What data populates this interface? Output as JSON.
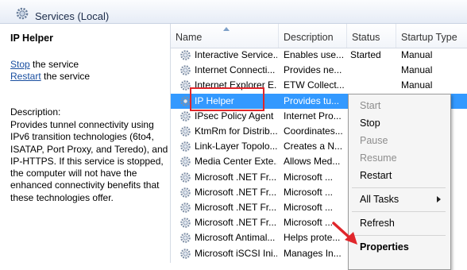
{
  "window": {
    "title": "Services (Local)",
    "icon": "gear-icon"
  },
  "left_pane": {
    "service_name": "IP Helper",
    "actions": [
      {
        "link": "Stop",
        "rest": " the service"
      },
      {
        "link": "Restart",
        "rest": " the service"
      }
    ],
    "description_label": "Description:",
    "description": "Provides tunnel connectivity using IPv6 transition technologies (6to4, ISATAP, Port Proxy, and Teredo), and IP-HTTPS. If this service is stopped, the computer will not have the enhanced connectivity benefits that these technologies offer."
  },
  "columns": {
    "name": "Name",
    "description": "Description",
    "status": "Status",
    "startup_type": "Startup Type"
  },
  "rows": [
    {
      "name": "Interactive Service...",
      "description": "Enables use...",
      "status": "Started",
      "startup": "Manual"
    },
    {
      "name": "Internet Connecti...",
      "description": "Provides ne...",
      "status": "",
      "startup": "Manual"
    },
    {
      "name": "Internet Explorer E...",
      "description": "ETW Collect...",
      "status": "",
      "startup": "Manual"
    },
    {
      "name": "IP Helper",
      "description": "Provides tu...",
      "status": "",
      "startup": "",
      "selected": true
    },
    {
      "name": "IPsec Policy Agent",
      "description": "Internet Pro...",
      "status": "",
      "startup": ""
    },
    {
      "name": "KtmRm for Distrib...",
      "description": "Coordinates...",
      "status": "",
      "startup": ""
    },
    {
      "name": "Link-Layer Topolo...",
      "description": "Creates a N...",
      "status": "",
      "startup": ""
    },
    {
      "name": "Media Center Exte...",
      "description": "Allows Med...",
      "status": "",
      "startup": ""
    },
    {
      "name": "Microsoft .NET Fr...",
      "description": "Microsoft ...",
      "status": "",
      "startup": ""
    },
    {
      "name": "Microsoft .NET Fr...",
      "description": "Microsoft ...",
      "status": "",
      "startup": ""
    },
    {
      "name": "Microsoft .NET Fr...",
      "description": "Microsoft ...",
      "status": "",
      "startup": ""
    },
    {
      "name": "Microsoft .NET Fr...",
      "description": "Microsoft ...",
      "status": "",
      "startup": ""
    },
    {
      "name": "Microsoft Antimal...",
      "description": "Helps prote...",
      "status": "",
      "startup": ""
    },
    {
      "name": "Microsoft iSCSI Ini...",
      "description": "Manages In...",
      "status": "",
      "startup": ""
    }
  ],
  "context_menu": {
    "items": [
      {
        "label": "Start",
        "enabled": false
      },
      {
        "label": "Stop",
        "enabled": true
      },
      {
        "label": "Pause",
        "enabled": false
      },
      {
        "label": "Resume",
        "enabled": false
      },
      {
        "label": "Restart",
        "enabled": true
      },
      {
        "label": "All Tasks",
        "enabled": true,
        "submenu": true
      },
      {
        "label": "Refresh",
        "enabled": true
      },
      {
        "label": "Properties",
        "enabled": true,
        "bold": true
      }
    ]
  },
  "colors": {
    "selection": "#3399ff",
    "highlight_box": "#e0262b",
    "link": "#1a4fa0"
  }
}
